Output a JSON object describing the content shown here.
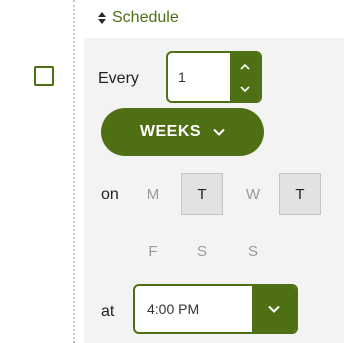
{
  "header": {
    "title": "Schedule",
    "icon": "sort-icon"
  },
  "recurrence": {
    "every_label": "Every",
    "interval_value": "1",
    "unit_label": "WEEKS",
    "on_label": "on",
    "at_label": "at",
    "time_value": "4:00 PM"
  },
  "days": [
    {
      "label": "M",
      "selected": false
    },
    {
      "label": "T",
      "selected": true
    },
    {
      "label": "W",
      "selected": false
    },
    {
      "label": "T",
      "selected": true
    },
    {
      "label": "F",
      "selected": false
    },
    {
      "label": "S",
      "selected": false
    },
    {
      "label": "S",
      "selected": false
    }
  ],
  "colors": {
    "accent": "#4f6f14",
    "panel_background": "#f3f3f3",
    "selected_day_background": "#e2e2e2"
  }
}
